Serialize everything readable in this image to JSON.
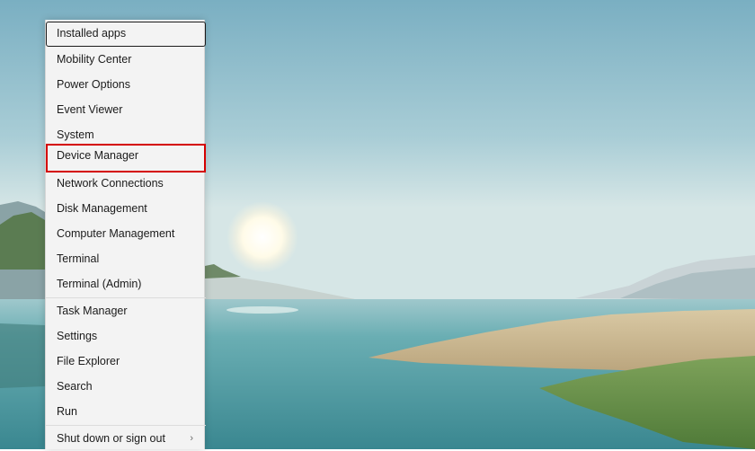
{
  "desktop": {
    "sky_top": "#7fb1c3",
    "sky_horizon": "#cfe2e6",
    "water": "#4f9aa1",
    "sun": "#fffef5"
  },
  "menu": {
    "items": [
      {
        "label": "Installed apps"
      },
      {
        "label": "Mobility Center"
      },
      {
        "label": "Power Options"
      },
      {
        "label": "Event Viewer"
      },
      {
        "label": "System"
      },
      {
        "label": "Device Manager"
      },
      {
        "label": "Network Connections"
      },
      {
        "label": "Disk Management"
      },
      {
        "label": "Computer Management"
      },
      {
        "label": "Terminal"
      },
      {
        "label": "Terminal (Admin)"
      },
      {
        "label": "Task Manager"
      },
      {
        "label": "Settings"
      },
      {
        "label": "File Explorer"
      },
      {
        "label": "Search"
      },
      {
        "label": "Run"
      },
      {
        "label": "Shut down or sign out",
        "submenu_icon": "chevron-right-icon"
      }
    ],
    "highlight_color": "#d40000"
  }
}
